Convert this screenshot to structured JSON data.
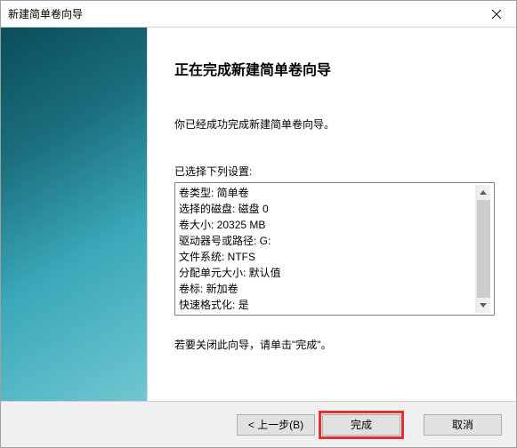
{
  "titlebar": {
    "title": "新建简单卷向导"
  },
  "content": {
    "heading": "正在完成新建简单卷向导",
    "intro": "你已经成功完成新建简单卷向导。",
    "settings_label": "已选择下列设置:",
    "settings_lines": [
      "卷类型: 简单卷",
      "选择的磁盘: 磁盘 0",
      "卷大小: 20325 MB",
      "驱动器号或路径: G:",
      "文件系统: NTFS",
      "分配单元大小: 默认值",
      "卷标: 新加卷",
      "快速格式化: 是"
    ],
    "closing": "若要关闭此向导，请单击\"完成\"。"
  },
  "footer": {
    "back": "< 上一步(B)",
    "finish": "完成",
    "cancel": "取消"
  }
}
